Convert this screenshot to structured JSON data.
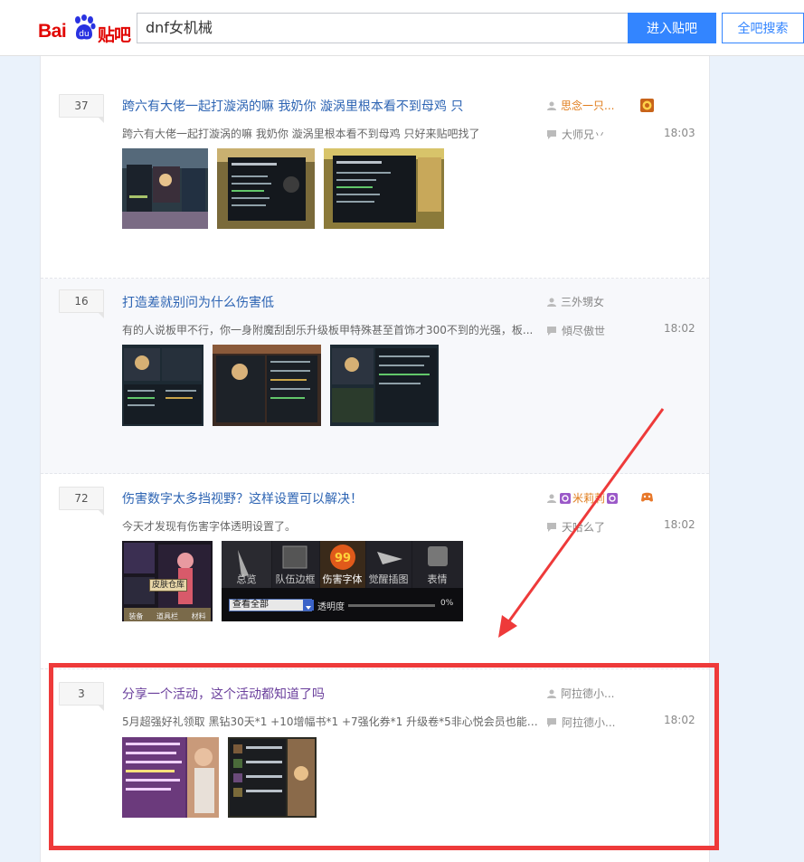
{
  "header": {
    "logo_text": "Bai",
    "logo_suffix": "贴吧",
    "search_value": "dnf女机械",
    "enter_button": "进入贴吧",
    "search_all_button": "全吧搜索"
  },
  "threads": [
    {
      "reply_count": "37",
      "title": "跨六有大佬一起打漩涡的嘛 我奶你 漩涡里根本看不到母鸡 只",
      "abstract": "跨六有大佬一起打漩涡的嘛 我奶你 漩涡里根本看不到母鸡 只好来贴吧找了",
      "author": "思念一只...",
      "last_replier": "大师兄丷",
      "time": "18:03",
      "thumbnails": [
        "dnf-screenshot",
        "dnf-screenshot",
        "dnf-screenshot"
      ]
    },
    {
      "reply_count": "16",
      "title": "打造差就别问为什么伤害低",
      "abstract": "有的人说板甲不行，你一身附魔刮刮乐升级板甲特殊甚至首饰才300不到的光强，板...",
      "author": "三外甥女",
      "last_replier": "傾尽傲世",
      "time": "18:02",
      "thumbnails": [
        "dnf-screenshot",
        "dnf-screenshot",
        "dnf-screenshot"
      ]
    },
    {
      "reply_count": "72",
      "title": "伤害数字太多挡视野？这样设置可以解决！",
      "abstract": "今天才发现有伤害字体透明设置了。",
      "author": "米莉莉",
      "last_replier": "天哈么了",
      "time": "18:02",
      "thumbnails": [
        "dnf-screenshot",
        "dnf-settings-panel"
      ],
      "settings_panel": {
        "tabs": [
          "总览",
          "队伍边框",
          "伤害字体",
          "觉醒插图",
          "表情"
        ],
        "dropdown_value": "查看全部",
        "opacity_label": "透明度",
        "opacity_value": "0%",
        "skin_label": "皮肤仓库",
        "bottom_labels": [
          "装备",
          "道具栏",
          "材料"
        ]
      }
    },
    {
      "reply_count": "3",
      "title": "分享一个活动，这个活动都知道了吗",
      "abstract": "5月超强好礼领取 黑钻30天*1 +10增幅书*1 +7强化券*1 升级卷*5非心悦会员也能领...",
      "author": "阿拉德小...",
      "last_replier": "阿拉德小...",
      "time": "18:02",
      "thumbnails": [
        "event-poster",
        "dnf-screenshot"
      ]
    }
  ],
  "colors": {
    "brand_red": "#e10602",
    "brand_blue": "#3385ff",
    "link_blue": "#2d64b3",
    "annotation_red": "#ee3a3a"
  }
}
